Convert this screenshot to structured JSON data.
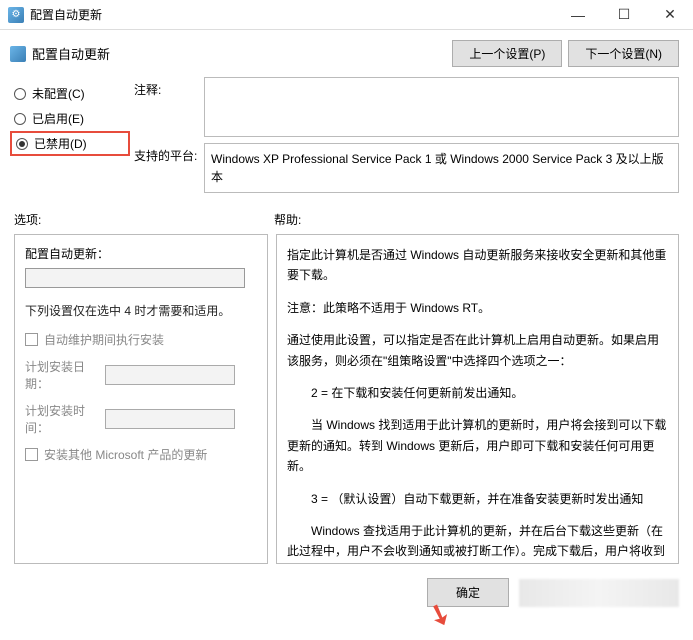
{
  "window": {
    "title": "配置自动更新"
  },
  "subheader": {
    "title": "配置自动更新"
  },
  "nav": {
    "prev": "上一个设置(P)",
    "next": "下一个设置(N)"
  },
  "radios": {
    "not_configured": "未配置(C)",
    "enabled": "已启用(E)",
    "disabled": "已禁用(D)"
  },
  "fields": {
    "comment_label": "注释:",
    "platform_label": "支持的平台:",
    "platform_value": "Windows XP Professional Service Pack 1 或 Windows 2000 Service Pack 3 及以上版本"
  },
  "sections": {
    "options": "选项:",
    "help": "帮助:"
  },
  "options": {
    "title": "配置自动更新：",
    "note": "下列设置仅在选中 4 时才需要和适用。",
    "checkbox_maintenance": "自动维护期间执行安装",
    "schedule_date_label": "计划安装日期：",
    "schedule_time_label": "计划安装时间：",
    "checkbox_other_products": "安装其他 Microsoft 产品的更新"
  },
  "help": {
    "p1": "指定此计算机是否通过 Windows 自动更新服务来接收安全更新和其他重要下载。",
    "p2": "注意：此策略不适用于 Windows RT。",
    "p3": "通过使用此设置，可以指定是否在此计算机上启用自动更新。如果启用该服务，则必须在\"组策略设置\"中选择四个选项之一：",
    "p4": "2 = 在下载和安装任何更新前发出通知。",
    "p5": "当 Windows 找到适用于此计算机的更新时，用户将会接到可以下载更新的通知。转到 Windows 更新后，用户即可下载和安装任何可用更新。",
    "p6": "3 = （默认设置）自动下载更新，并在准备安装更新时发出通知",
    "p7": "Windows 查找适用于此计算机的更新，并在后台下载这些更新（在此过程中，用户不会收到通知或被打断工作）。完成下载后，用户将收到可以安装更新的通知。转到 Windows 更新后，"
  },
  "footer": {
    "ok": "确定"
  }
}
